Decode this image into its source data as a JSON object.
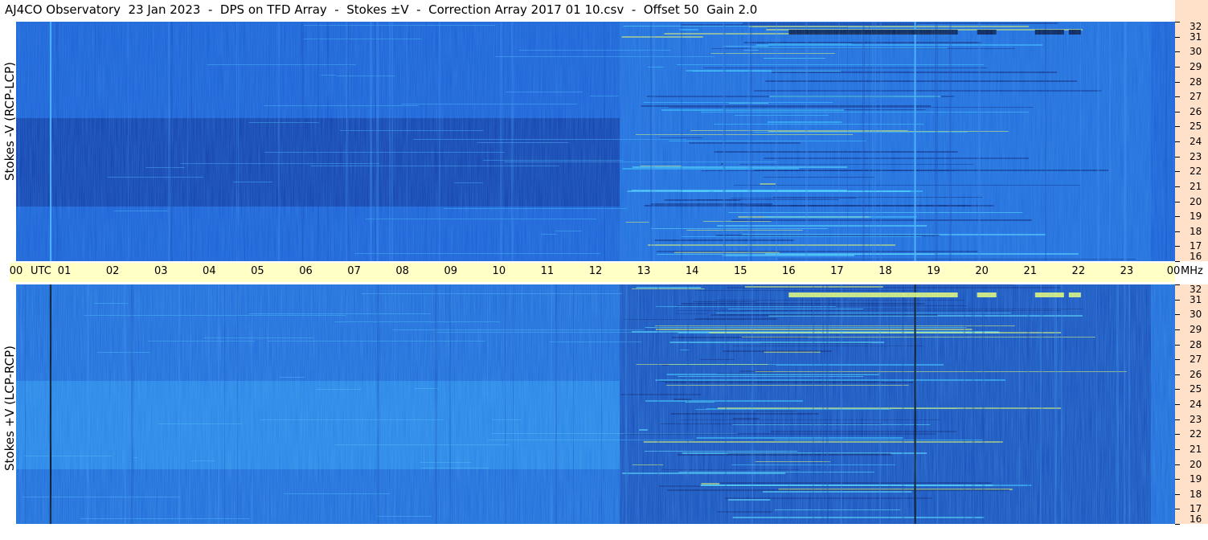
{
  "title": "AJ4CO Observatory  23 Jan 2023  -  DPS on TFD Array  -  Stokes ±V  -  Correction Array 2017 01 10.csv  -  Offset 50  Gain 2.0",
  "chart_data": {
    "type": "heatmap",
    "x_unit_label": "UTC",
    "y_unit_label": "MHz",
    "x_ticks": [
      "00",
      "01",
      "02",
      "03",
      "04",
      "05",
      "06",
      "07",
      "08",
      "09",
      "10",
      "11",
      "12",
      "13",
      "14",
      "15",
      "16",
      "17",
      "18",
      "19",
      "20",
      "21",
      "22",
      "23",
      "00"
    ],
    "x_range_hours": [
      0,
      24
    ],
    "y_range_mhz": [
      16,
      32
    ],
    "y_ticks": [
      32,
      31,
      30,
      29,
      28,
      27,
      26,
      25,
      24,
      23,
      22,
      21,
      20,
      19,
      18,
      17,
      16
    ],
    "panels": [
      {
        "name": "Stokes -V (RCP-LCP)",
        "position": "top"
      },
      {
        "name": "Stokes +V (LCP-RCP)",
        "position": "bottom"
      }
    ],
    "colors": {
      "low": "#0a1a6b",
      "mid": "#1c6fe0",
      "high": "#3fd0ff",
      "peak": "#f5ff5a",
      "axis_band": "#ffffc6",
      "freq_strip": "#ffe0c9"
    }
  }
}
